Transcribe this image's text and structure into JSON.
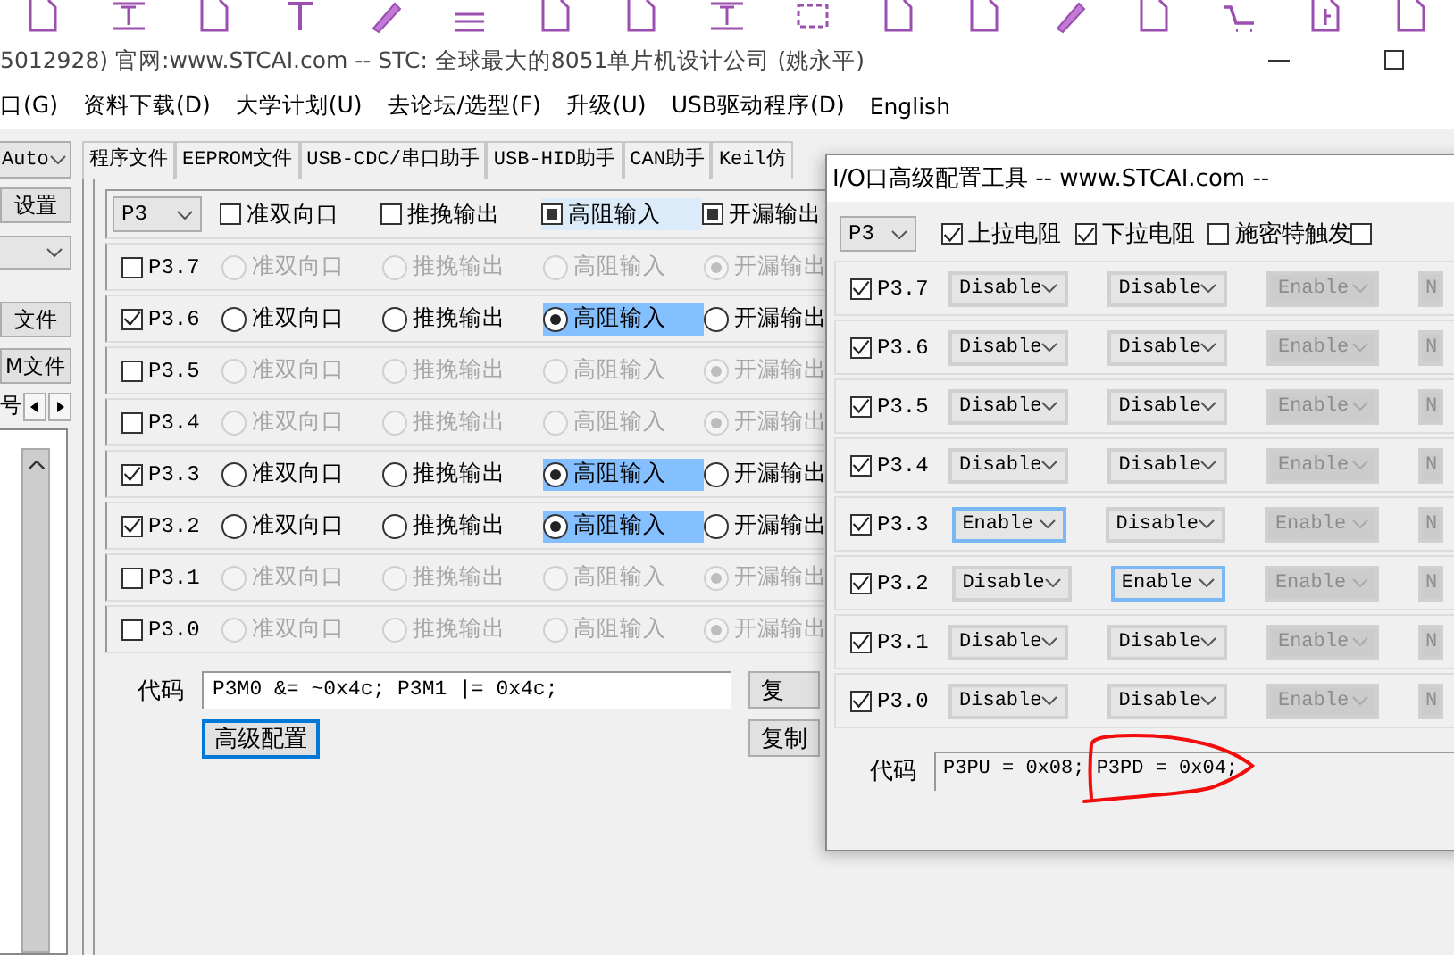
{
  "window": {
    "title": "5012928) 官网:www.STCAI.com  -- STC: 全球最大的8051单片机设计公司 (姚永平)"
  },
  "menu": [
    "口(G)",
    "资料下载(D)",
    "大学计划(U)",
    "去论坛/选型(F)",
    "升级(U)",
    "USB驱动程序(D)",
    "English"
  ],
  "left_panel": {
    "mode": "Auto",
    "settings_button": "设置",
    "file_buttons": [
      "文件",
      "M文件"
    ],
    "serial_label": "号"
  },
  "tabs": [
    {
      "label": "程序文件",
      "selected": false
    },
    {
      "label": "EEPROM文件",
      "selected": false
    },
    {
      "label": "USB-CDC/串口助手",
      "selected": false
    },
    {
      "label": "USB-HID助手",
      "selected": false
    },
    {
      "label": "CAN助手",
      "selected": false
    },
    {
      "label": "Keil仿",
      "selected": false
    }
  ],
  "io_panel": {
    "port": "P3",
    "headers": [
      {
        "label": "准双向口",
        "checked": false,
        "hovered": false
      },
      {
        "label": "推挽输出",
        "checked": false,
        "hovered": false
      },
      {
        "label": "高阻输入",
        "checked": true,
        "hovered": true
      },
      {
        "label": "开漏输出",
        "checked": true,
        "hovered": false
      }
    ],
    "rows": [
      {
        "pin": "P3.7",
        "checked": false,
        "modes": [
          {
            "label": "准双向口",
            "selected": false
          },
          {
            "label": "推挽输出",
            "selected": false
          },
          {
            "label": "高阻输入",
            "selected": false
          },
          {
            "label": "开漏输出",
            "selected": true
          }
        ]
      },
      {
        "pin": "P3.6",
        "checked": true,
        "modes": [
          {
            "label": "准双向口",
            "selected": false
          },
          {
            "label": "推挽输出",
            "selected": false
          },
          {
            "label": "高阻输入",
            "selected": true
          },
          {
            "label": "开漏输出",
            "selected": false
          }
        ]
      },
      {
        "pin": "P3.5",
        "checked": false,
        "modes": [
          {
            "label": "准双向口",
            "selected": false
          },
          {
            "label": "推挽输出",
            "selected": false
          },
          {
            "label": "高阻输入",
            "selected": false
          },
          {
            "label": "开漏输出",
            "selected": true
          }
        ]
      },
      {
        "pin": "P3.4",
        "checked": false,
        "modes": [
          {
            "label": "准双向口",
            "selected": false
          },
          {
            "label": "推挽输出",
            "selected": false
          },
          {
            "label": "高阻输入",
            "selected": false
          },
          {
            "label": "开漏输出",
            "selected": true
          }
        ]
      },
      {
        "pin": "P3.3",
        "checked": true,
        "modes": [
          {
            "label": "准双向口",
            "selected": false
          },
          {
            "label": "推挽输出",
            "selected": false
          },
          {
            "label": "高阻输入",
            "selected": true
          },
          {
            "label": "开漏输出",
            "selected": false
          }
        ]
      },
      {
        "pin": "P3.2",
        "checked": true,
        "modes": [
          {
            "label": "准双向口",
            "selected": false
          },
          {
            "label": "推挽输出",
            "selected": false
          },
          {
            "label": "高阻输入",
            "selected": true
          },
          {
            "label": "开漏输出",
            "selected": false
          }
        ]
      },
      {
        "pin": "P3.1",
        "checked": false,
        "modes": [
          {
            "label": "准双向口",
            "selected": false
          },
          {
            "label": "推挽输出",
            "selected": false
          },
          {
            "label": "高阻输入",
            "selected": false
          },
          {
            "label": "开漏输出",
            "selected": true
          }
        ]
      },
      {
        "pin": "P3.0",
        "checked": false,
        "modes": [
          {
            "label": "准双向口",
            "selected": false
          },
          {
            "label": "推挽输出",
            "selected": false
          },
          {
            "label": "高阻输入",
            "selected": false
          },
          {
            "label": "开漏输出",
            "selected": true
          }
        ]
      }
    ],
    "code_label": "代码",
    "code": "P3M0 &= ~0x4c; P3M1 |= 0x4c;",
    "advanced_button": {
      "label": "高级配置",
      "focused": true
    },
    "copy_buttons": [
      "复",
      "复制"
    ]
  },
  "dialog": {
    "title": "I/O口高级配置工具 -- www.STCAI.com --",
    "port": "P3",
    "options": [
      {
        "label": "上拉电阻",
        "checked": true
      },
      {
        "label": "下拉电阻",
        "checked": true
      },
      {
        "label": "施密特触发",
        "checked": false
      },
      {
        "checked": false
      }
    ],
    "rows": [
      {
        "pin": "P3.7",
        "checked": true,
        "settings": [
          {
            "value": "Disable",
            "disabled": false,
            "focused": false
          },
          {
            "value": "Disable",
            "disabled": false,
            "focused": false
          },
          {
            "value": "Enable",
            "disabled": true,
            "focused": false
          },
          {
            "value": "N",
            "disabled": true,
            "focused": false
          }
        ]
      },
      {
        "pin": "P3.6",
        "checked": true,
        "settings": [
          {
            "value": "Disable",
            "disabled": false,
            "focused": false
          },
          {
            "value": "Disable",
            "disabled": false,
            "focused": false
          },
          {
            "value": "Enable",
            "disabled": true,
            "focused": false
          },
          {
            "value": "N",
            "disabled": true,
            "focused": false
          }
        ]
      },
      {
        "pin": "P3.5",
        "checked": true,
        "settings": [
          {
            "value": "Disable",
            "disabled": false,
            "focused": false
          },
          {
            "value": "Disable",
            "disabled": false,
            "focused": false
          },
          {
            "value": "Enable",
            "disabled": true,
            "focused": false
          },
          {
            "value": "N",
            "disabled": true,
            "focused": false
          }
        ]
      },
      {
        "pin": "P3.4",
        "checked": true,
        "settings": [
          {
            "value": "Disable",
            "disabled": false,
            "focused": false
          },
          {
            "value": "Disable",
            "disabled": false,
            "focused": false
          },
          {
            "value": "Enable",
            "disabled": true,
            "focused": false
          },
          {
            "value": "N",
            "disabled": true,
            "focused": false
          }
        ]
      },
      {
        "pin": "P3.3",
        "checked": true,
        "settings": [
          {
            "value": "Enable",
            "disabled": false,
            "focused": true
          },
          {
            "value": "Disable",
            "disabled": false,
            "focused": false
          },
          {
            "value": "Enable",
            "disabled": true,
            "focused": false
          },
          {
            "value": "N",
            "disabled": true,
            "focused": false
          }
        ]
      },
      {
        "pin": "P3.2",
        "checked": true,
        "settings": [
          {
            "value": "Disable",
            "disabled": false,
            "focused": false
          },
          {
            "value": "Enable",
            "disabled": false,
            "focused": true
          },
          {
            "value": "Enable",
            "disabled": true,
            "focused": false
          },
          {
            "value": "N",
            "disabled": true,
            "focused": false
          }
        ]
      },
      {
        "pin": "P3.1",
        "checked": true,
        "settings": [
          {
            "value": "Disable",
            "disabled": false,
            "focused": false
          },
          {
            "value": "Disable",
            "disabled": false,
            "focused": false
          },
          {
            "value": "Enable",
            "disabled": true,
            "focused": false
          },
          {
            "value": "N",
            "disabled": true,
            "focused": false
          }
        ]
      },
      {
        "pin": "P3.0",
        "checked": true,
        "settings": [
          {
            "value": "Disable",
            "disabled": false,
            "focused": false
          },
          {
            "value": "Disable",
            "disabled": false,
            "focused": false
          },
          {
            "value": "Enable",
            "disabled": true,
            "focused": false
          },
          {
            "value": "N",
            "disabled": true,
            "focused": false
          }
        ]
      }
    ],
    "code_label": "代码",
    "code": "P3PU = 0x08; P3PD = 0x04;"
  }
}
